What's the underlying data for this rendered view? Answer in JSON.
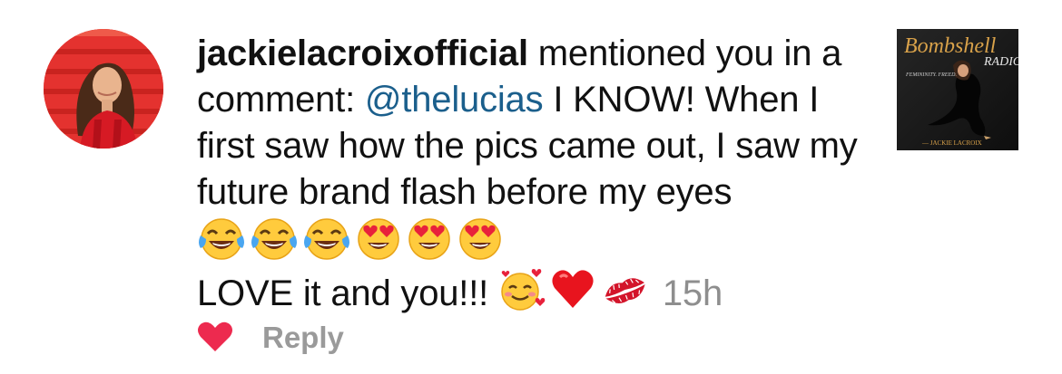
{
  "notification": {
    "username": "jackielacroixofficial",
    "action_text": " mentioned you in a comment: ",
    "mention": "@thelucias",
    "comment_line1": " I KNOW! When I first saw how the pics came out, I saw my future brand flash before my eyes",
    "comment_line2": "LOVE it and you!!!",
    "timestamp": "15h",
    "emojis_row1": [
      "face-with-tears-of-joy",
      "face-with-tears-of-joy",
      "face-with-tears-of-joy",
      "heart-eyes",
      "heart-eyes",
      "heart-eyes"
    ],
    "emojis_row2": [
      "smiling-face-with-hearts",
      "red-heart",
      "kiss-mark"
    ]
  },
  "thumbnail": {
    "title": "Bombshell",
    "subtitle": "RADIO",
    "tagline": "FEMININITY. FREED.",
    "author": "— JACKIE LACROIX"
  },
  "actions": {
    "like_icon": "heart-icon",
    "like_color": "#ed2a4f",
    "reply_label": "Reply"
  },
  "colors": {
    "mention": "#1b5f8c",
    "timestamp": "#8e8e8e",
    "reply": "#9a9a9a",
    "avatar_bg": "#e4322f",
    "thumbnail_title": "#d9a24a"
  }
}
